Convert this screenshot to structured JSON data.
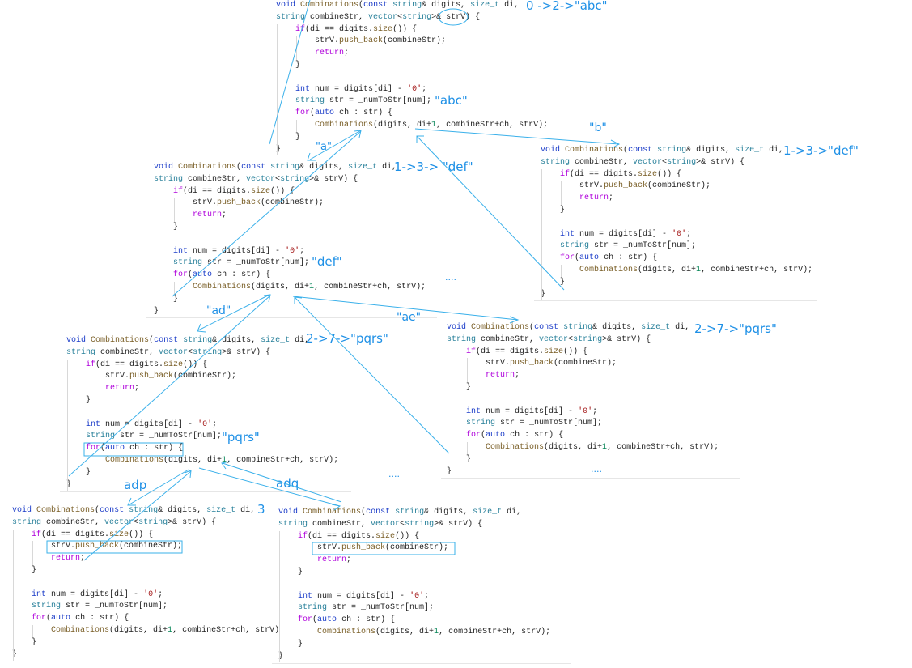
{
  "colors": {
    "annotation": "#1e90e6",
    "keyword": "#1a3bc8",
    "type": "#267f99",
    "function": "#795e26",
    "control": "#af00db",
    "char_literal": "#a31515",
    "number": "#098658"
  },
  "code_blocks": [
    {
      "id": "call-0",
      "lines": [
        "void Combinations(const string& digits, size_t di,",
        "string combineStr, vector<string>& strV) {",
        "    if(di == digits.size()) {",
        "        strV.push_back(combineStr);",
        "        return;",
        "    }",
        "",
        "    int num = digits[di] - '0';",
        "    string str = _numToStr[num];",
        "    for(auto ch : str) {",
        "        Combinations(digits, di+1, combineStr+ch, strV);",
        "    }",
        "}"
      ]
    },
    {
      "id": "call-1-a",
      "lines": [
        "void Combinations(const string& digits, size_t di,",
        "string combineStr, vector<string>& strV) {",
        "    if(di == digits.size()) {",
        "        strV.push_back(combineStr);",
        "        return;",
        "    }",
        "",
        "    int num = digits[di] - '0';",
        "    string str = _numToStr[num];",
        "    for(auto ch : str) {",
        "        Combinations(digits, di+1, combineStr+ch, strV);",
        "    }",
        "}"
      ]
    },
    {
      "id": "call-1-b",
      "lines": [
        "void Combinations(const string& digits, size_t di,",
        "string combineStr, vector<string>& strV) {",
        "    if(di == digits.size()) {",
        "        strV.push_back(combineStr);",
        "        return;",
        "    }",
        "",
        "    int num = digits[di] - '0';",
        "    string str = _numToStr[num];",
        "    for(auto ch : str) {",
        "        Combinations(digits, di+1, combineStr+ch, strV);",
        "    }",
        "}"
      ]
    },
    {
      "id": "call-2-ad",
      "lines": [
        "void Combinations(const string& digits, size_t di,",
        "string combineStr, vector<string>& strV) {",
        "    if(di == digits.size()) {",
        "        strV.push_back(combineStr);",
        "        return;",
        "    }",
        "",
        "    int num = digits[di] - '0';",
        "    string str = _numToStr[num];",
        "    for(auto ch : str) {",
        "        Combinations(digits, di+1, combineStr+ch, strV);",
        "    }",
        "}"
      ]
    },
    {
      "id": "call-2-ae",
      "lines": [
        "void Combinations(const string& digits, size_t di,",
        "string combineStr, vector<string>& strV) {",
        "    if(di == digits.size()) {",
        "        strV.push_back(combineStr);",
        "        return;",
        "    }",
        "",
        "    int num = digits[di] - '0';",
        "    string str = _numToStr[num];",
        "    for(auto ch : str) {",
        "        Combinations(digits, di+1, combineStr+ch, strV);",
        "    }",
        "}"
      ]
    },
    {
      "id": "call-3-adp",
      "lines": [
        "void Combinations(const string& digits, size_t di,",
        "string combineStr, vector<string>& strV) {",
        "    if(di == digits.size()) {",
        "        strV.push_back(combineStr);",
        "        return;",
        "    }",
        "",
        "    int num = digits[di] - '0';",
        "    string str = _numToStr[num];",
        "    for(auto ch : str) {",
        "        Combinations(digits, di+1, combineStr+ch, strV)",
        "    }",
        "}"
      ]
    },
    {
      "id": "call-3-adq",
      "lines": [
        "void Combinations(const string& digits, size_t di,",
        "string combineStr, vector<string>& strV) {",
        "    if(di == digits.size()) {",
        "        strV.push_back(combineStr);",
        "        return;",
        "    }",
        "",
        "    int num = digits[di] - '0';",
        "    string str = _numToStr[num];",
        "    for(auto ch : str) {",
        "        Combinations(digits, di+1, combineStr+ch, strV);",
        "    }",
        "}"
      ]
    }
  ],
  "annotations": {
    "a0": "0 ->2->\"abc\"",
    "a1": "\"abc\"",
    "a2": "\"a\"",
    "a3": "\"b\"",
    "a4": "1->3-> \"def\"",
    "a5": "1->3->\"def\"",
    "a6": "\"def\"",
    "a7": "....",
    "a8": "\"ad\"",
    "a9": "\"ae\"",
    "a10": "2->7->\"pqrs\"",
    "a11": "2->7->\"pqrs\"",
    "a12": "\"pqrs\"",
    "a13": "....",
    "a14": "....",
    "a15": "adp",
    "a16": "adq",
    "a17": "3"
  }
}
